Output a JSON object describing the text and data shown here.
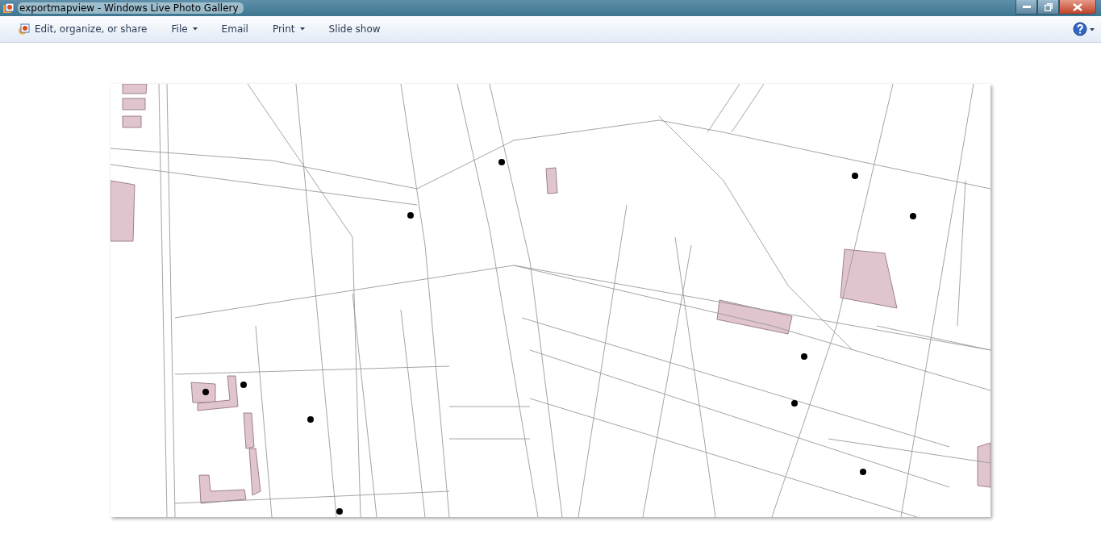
{
  "window": {
    "title": "exportmapview - Windows Live Photo Gallery"
  },
  "toolbar": [
    {
      "label": "Edit, organize, or share",
      "kind": "app"
    },
    {
      "label": "File",
      "kind": "dropdown"
    },
    {
      "label": "Email",
      "kind": "plain"
    },
    {
      "label": "Print",
      "kind": "dropdown"
    },
    {
      "label": "Slide show",
      "kind": "plain"
    }
  ]
}
